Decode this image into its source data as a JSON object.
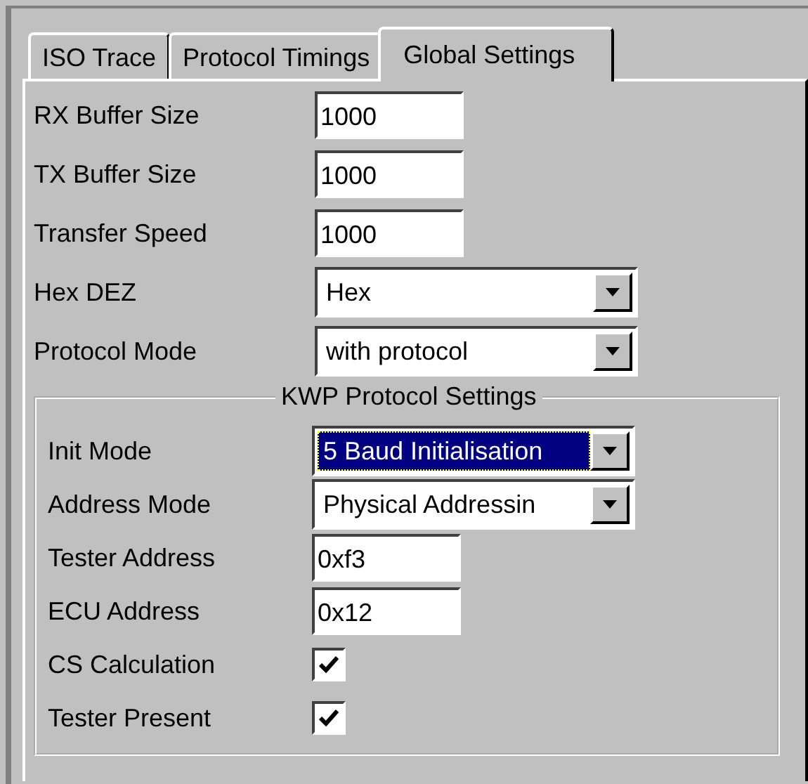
{
  "tabs": [
    {
      "label": "ISO Trace",
      "selected": false
    },
    {
      "label": "Protocol Timings",
      "selected": false
    },
    {
      "label": "Global Settings",
      "selected": true
    }
  ],
  "fields": [
    {
      "kind": "text",
      "label": "RX Buffer Size",
      "value": "1000"
    },
    {
      "kind": "text",
      "label": "TX Buffer Size",
      "value": "1000"
    },
    {
      "kind": "text",
      "label": "Transfer Speed",
      "value": "1000"
    },
    {
      "kind": "dropdown",
      "label": "Hex DEZ",
      "value": "Hex",
      "focused": false
    },
    {
      "kind": "dropdown",
      "label": "Protocol Mode",
      "value": "with protocol",
      "focused": false
    }
  ],
  "group": {
    "title": "KWP Protocol Settings",
    "fields": [
      {
        "kind": "dropdown",
        "label": "Init Mode",
        "value": "5 Baud Initialisation",
        "focused": true
      },
      {
        "kind": "dropdown",
        "label": "Address Mode",
        "value": "Physical Addressin",
        "focused": false
      },
      {
        "kind": "text",
        "label": "Tester Address",
        "value": "0xf3"
      },
      {
        "kind": "text",
        "label": "ECU Address",
        "value": "0x12"
      },
      {
        "kind": "checkbox",
        "label": "CS Calculation",
        "checked": true
      },
      {
        "kind": "checkbox",
        "label": "Tester Present",
        "checked": true
      }
    ]
  }
}
